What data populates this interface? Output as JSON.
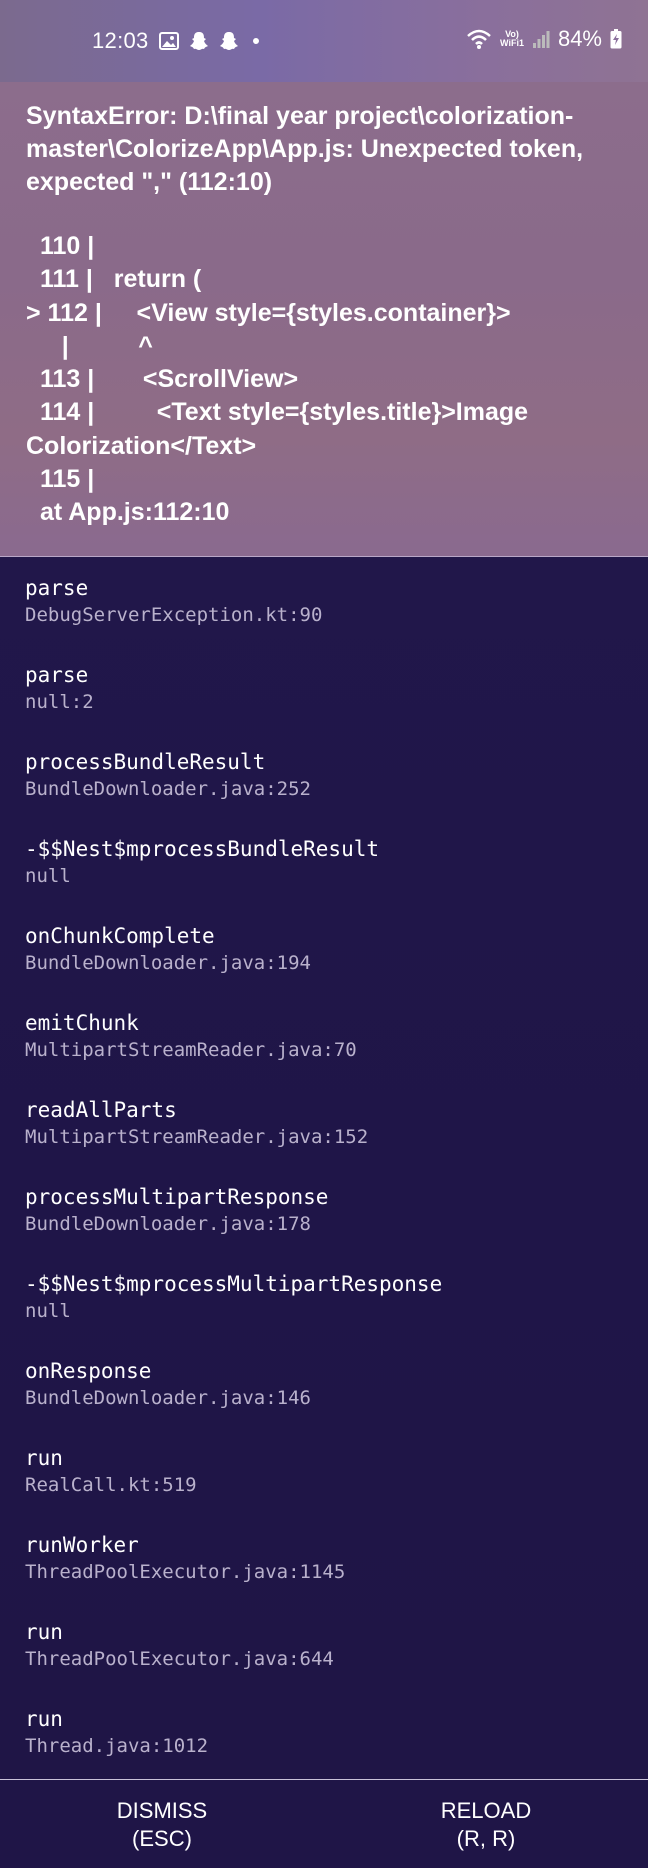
{
  "status_bar": {
    "time": "12:03",
    "icons": [
      "gallery-icon",
      "snapchat-icon",
      "snapchat-icon",
      "dot-icon"
    ],
    "network_label_top": "Vo)",
    "network_label_bottom": "WiFi1",
    "battery_percent": "84%"
  },
  "error": {
    "message": "SyntaxError: D:\\final year project\\colorization-master\\ColorizeApp\\App.js: Unexpected token, expected \",\" (112:10)",
    "code_frame": [
      "110 |",
      "111 |   return (",
      "> 112 |     <View style={styles.container}>",
      "    |          ^",
      "113 |       <ScrollView>",
      "114 |         <Text style={styles.title}>Image",
      "Colorization</Text>",
      "115 |",
      "at App.js:112:10"
    ]
  },
  "stack_frames": [
    {
      "method": "parse",
      "file": "DebugServerException.kt:90"
    },
    {
      "method": "parse",
      "file": "null:2"
    },
    {
      "method": "processBundleResult",
      "file": "BundleDownloader.java:252"
    },
    {
      "method": "-$$Nest$mprocessBundleResult",
      "file": "null"
    },
    {
      "method": "onChunkComplete",
      "file": "BundleDownloader.java:194"
    },
    {
      "method": "emitChunk",
      "file": "MultipartStreamReader.java:70"
    },
    {
      "method": "readAllParts",
      "file": "MultipartStreamReader.java:152"
    },
    {
      "method": "processMultipartResponse",
      "file": "BundleDownloader.java:178"
    },
    {
      "method": "-$$Nest$mprocessMultipartResponse",
      "file": "null"
    },
    {
      "method": "onResponse",
      "file": "BundleDownloader.java:146"
    },
    {
      "method": "run",
      "file": "RealCall.kt:519"
    },
    {
      "method": "runWorker",
      "file": "ThreadPoolExecutor.java:1145"
    },
    {
      "method": "run",
      "file": "ThreadPoolExecutor.java:644"
    },
    {
      "method": "run",
      "file": "Thread.java:1012"
    }
  ],
  "footer": {
    "dismiss_label": "DISMISS",
    "dismiss_shortcut": "(ESC)",
    "reload_label": "RELOAD",
    "reload_shortcut": "(R, R)"
  }
}
